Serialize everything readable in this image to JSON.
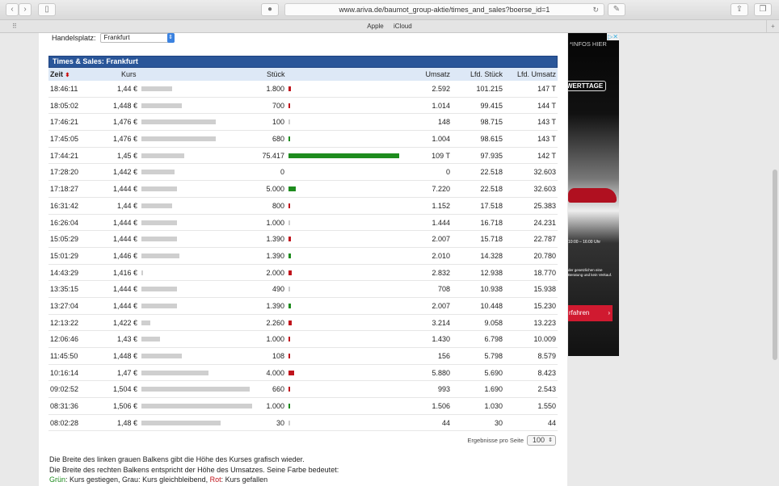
{
  "browser": {
    "url": "www.ariva.de/baumot_group-aktie/times_and_sales?boerse_id=1",
    "bookmarks": [
      "Apple",
      "iCloud"
    ],
    "back": "‹",
    "forward": "›",
    "reload": "↻",
    "new_tab": "+"
  },
  "handelsplatz": {
    "label": "Handelsplatz:",
    "value": "Frankfurt"
  },
  "table": {
    "title": "Times & Sales: Frankfurt",
    "headers": {
      "zeit": "Zeit",
      "kurs": "Kurs",
      "stueck": "Stück",
      "umsatz": "Umsatz",
      "lfd_stueck": "Lfd. Stück",
      "lfd_umsatz": "Lfd. Umsatz"
    },
    "rows": [
      {
        "zeit": "18:46:11",
        "kurs": "1,44 €",
        "k": 1.44,
        "stueck": "1.800",
        "s": 1800,
        "dir": "down",
        "umsatz": "2.592",
        "lfd_stueck": "101.215",
        "lfd_umsatz": "147 T"
      },
      {
        "zeit": "18:05:02",
        "kurs": "1,448 €",
        "k": 1.448,
        "stueck": "700",
        "s": 700,
        "dir": "down",
        "umsatz": "1.014",
        "lfd_stueck": "99.415",
        "lfd_umsatz": "144 T"
      },
      {
        "zeit": "17:46:21",
        "kurs": "1,476 €",
        "k": 1.476,
        "stueck": "100",
        "s": 100,
        "dir": "same",
        "umsatz": "148",
        "lfd_stueck": "98.715",
        "lfd_umsatz": "143 T"
      },
      {
        "zeit": "17:45:05",
        "kurs": "1,476 €",
        "k": 1.476,
        "stueck": "680",
        "s": 680,
        "dir": "up",
        "umsatz": "1.004",
        "lfd_stueck": "98.615",
        "lfd_umsatz": "143 T"
      },
      {
        "zeit": "17:44:21",
        "kurs": "1,45 €",
        "k": 1.45,
        "stueck": "75.417",
        "s": 75417,
        "dir": "up",
        "umsatz": "109 T",
        "lfd_stueck": "97.935",
        "lfd_umsatz": "142 T"
      },
      {
        "zeit": "17:28:20",
        "kurs": "1,442 €",
        "k": 1.442,
        "stueck": "0",
        "s": 0,
        "dir": "none",
        "umsatz": "0",
        "lfd_stueck": "22.518",
        "lfd_umsatz": "32.603"
      },
      {
        "zeit": "17:18:27",
        "kurs": "1,444 €",
        "k": 1.444,
        "stueck": "5.000",
        "s": 5000,
        "dir": "up",
        "umsatz": "7.220",
        "lfd_stueck": "22.518",
        "lfd_umsatz": "32.603"
      },
      {
        "zeit": "16:31:42",
        "kurs": "1,44 €",
        "k": 1.44,
        "stueck": "800",
        "s": 800,
        "dir": "down",
        "umsatz": "1.152",
        "lfd_stueck": "17.518",
        "lfd_umsatz": "25.383"
      },
      {
        "zeit": "16:26:04",
        "kurs": "1,444 €",
        "k": 1.444,
        "stueck": "1.000",
        "s": 1000,
        "dir": "same",
        "umsatz": "1.444",
        "lfd_stueck": "16.718",
        "lfd_umsatz": "24.231"
      },
      {
        "zeit": "15:05:29",
        "kurs": "1,444 €",
        "k": 1.444,
        "stueck": "1.390",
        "s": 1390,
        "dir": "down",
        "umsatz": "2.007",
        "lfd_stueck": "15.718",
        "lfd_umsatz": "22.787"
      },
      {
        "zeit": "15:01:29",
        "kurs": "1,446 €",
        "k": 1.446,
        "stueck": "1.390",
        "s": 1390,
        "dir": "up",
        "umsatz": "2.010",
        "lfd_stueck": "14.328",
        "lfd_umsatz": "20.780"
      },
      {
        "zeit": "14:43:29",
        "kurs": "1,416 €",
        "k": 1.416,
        "stueck": "2.000",
        "s": 2000,
        "dir": "down",
        "umsatz": "2.832",
        "lfd_stueck": "12.938",
        "lfd_umsatz": "18.770"
      },
      {
        "zeit": "13:35:15",
        "kurs": "1,444 €",
        "k": 1.444,
        "stueck": "490",
        "s": 490,
        "dir": "same",
        "umsatz": "708",
        "lfd_stueck": "10.938",
        "lfd_umsatz": "15.938"
      },
      {
        "zeit": "13:27:04",
        "kurs": "1,444 €",
        "k": 1.444,
        "stueck": "1.390",
        "s": 1390,
        "dir": "up",
        "umsatz": "2.007",
        "lfd_stueck": "10.448",
        "lfd_umsatz": "15.230"
      },
      {
        "zeit": "12:13:22",
        "kurs": "1,422 €",
        "k": 1.422,
        "stueck": "2.260",
        "s": 2260,
        "dir": "down",
        "umsatz": "3.214",
        "lfd_stueck": "9.058",
        "lfd_umsatz": "13.223"
      },
      {
        "zeit": "12:06:46",
        "kurs": "1,43 €",
        "k": 1.43,
        "stueck": "1.000",
        "s": 1000,
        "dir": "down",
        "umsatz": "1.430",
        "lfd_stueck": "6.798",
        "lfd_umsatz": "10.009"
      },
      {
        "zeit": "11:45:50",
        "kurs": "1,448 €",
        "k": 1.448,
        "stueck": "108",
        "s": 108,
        "dir": "down",
        "umsatz": "156",
        "lfd_stueck": "5.798",
        "lfd_umsatz": "8.579"
      },
      {
        "zeit": "10:16:14",
        "kurs": "1,47 €",
        "k": 1.47,
        "stueck": "4.000",
        "s": 4000,
        "dir": "down",
        "umsatz": "5.880",
        "lfd_stueck": "5.690",
        "lfd_umsatz": "8.423"
      },
      {
        "zeit": "09:02:52",
        "kurs": "1,504 €",
        "k": 1.504,
        "stueck": "660",
        "s": 660,
        "dir": "down",
        "umsatz": "993",
        "lfd_stueck": "1.690",
        "lfd_umsatz": "2.543"
      },
      {
        "zeit": "08:31:36",
        "kurs": "1,506 €",
        "k": 1.506,
        "stueck": "1.000",
        "s": 1000,
        "dir": "up",
        "umsatz": "1.506",
        "lfd_stueck": "1.030",
        "lfd_umsatz": "1.550"
      },
      {
        "zeit": "08:02:28",
        "kurs": "1,48 €",
        "k": 1.48,
        "stueck": "30",
        "s": 30,
        "dir": "same",
        "umsatz": "44",
        "lfd_stueck": "30",
        "lfd_umsatz": "44"
      }
    ]
  },
  "pagination": {
    "label": "Ergebnisse pro Seite",
    "value": "100"
  },
  "legend": {
    "line1": "Die Breite des linken grauen Balkens gibt die Höhe des Kurses grafisch wieder.",
    "line2": "Die Breite des rechten Balkens entspricht der Höhe des Umsatzes. Seine Farbe bedeutet:",
    "gruen": "Grün",
    "gruen_text": ": Kurs gestiegen, Grau: Kurs gleichbleibend, ",
    "rot": "Rot",
    "rot_text": ": Kurs gefallen"
  },
  "ad": {
    "top": "*INFOS HIER",
    "badge": "WERTTAGE",
    "time": "10:00 – 16:00 Uhr",
    "small": "der gesetzlichen eine Beratung und kein Verkauf.",
    "cta": "rfahren"
  },
  "colors": {
    "up": "#1e8c1e",
    "down": "#c0141c",
    "same": "#cccccc",
    "header": "#2a5699"
  }
}
